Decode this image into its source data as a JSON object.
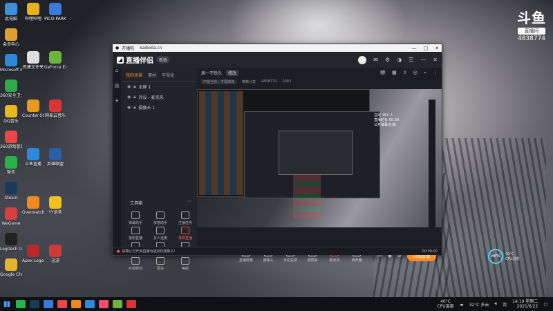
{
  "desktop": {
    "icons": [
      {
        "label": "此电脑",
        "color": "#3e8fd9"
      },
      {
        "label": "会员中心",
        "color": "#e0a030"
      },
      {
        "label": "Microsoft Edge",
        "color": "#2b8ad9"
      },
      {
        "label": "360安全卫士",
        "color": "#2ea84a"
      },
      {
        "label": "QQ音乐",
        "color": "#e8b820"
      },
      {
        "label": "360游戏管家",
        "color": "#e94848"
      },
      {
        "label": "微信",
        "color": "#27b34a"
      },
      {
        "label": "Steam",
        "color": "#1c3a5a"
      },
      {
        "label": "WeGame",
        "color": "#d64040"
      },
      {
        "label": "Logitech G HUB",
        "color": "#222"
      },
      {
        "label": "Google Chrome",
        "color": "#e4b42a"
      }
    ],
    "icons_col2": [
      {
        "label": "哔哩哔哩",
        "color": "#e8b020"
      },
      {
        "label": "新建文件夹",
        "color": "#ddd"
      },
      {
        "label": "Counter-Strike",
        "color": "#e89a20"
      },
      {
        "label": "斗鱼直播",
        "color": "#2b8ad9"
      },
      {
        "label": "Overwatch",
        "color": "#f08a20"
      },
      {
        "label": "Apex Legends",
        "color": "#b82a2a"
      }
    ],
    "icons_col3": [
      {
        "label": "PICO PARK",
        "color": "#3a7ad9"
      },
      {
        "label": "GeForce Experience",
        "color": "#6db33f"
      },
      {
        "label": "网易云音乐",
        "color": "#d33"
      },
      {
        "label": "英雄联盟",
        "color": "#2a5ea8"
      },
      {
        "label": "YY语音",
        "color": "#f0c020"
      },
      {
        "label": "迅游",
        "color": "#cc3a3a"
      }
    ]
  },
  "watermark": {
    "logo": "斗鱼",
    "badge": "直播间",
    "room_id": "4838774"
  },
  "app": {
    "titlebar": {
      "title": "开播啦",
      "url": "kaiboila.cn",
      "min": "—",
      "max": "□",
      "close": "✕"
    },
    "brand": "直播伴侣",
    "version": "新版",
    "left_tabs": [
      "我的场景",
      "素材",
      "可视化"
    ],
    "scenes": [
      {
        "label": "全屏 1"
      },
      {
        "label": "外设 - 麦克风"
      },
      {
        "label": "摄像头 1"
      }
    ],
    "tools_title": "工具箱",
    "tools": [
      {
        "label": "弹幕助手",
        "highlight": false
      },
      {
        "label": "房管助手",
        "highlight": false
      },
      {
        "label": "主播任务",
        "highlight": false
      },
      {
        "label": "视频直播",
        "highlight": false
      },
      {
        "label": "多人连麦",
        "highlight": false
      },
      {
        "label": "录屏直播",
        "highlight": true
      },
      {
        "label": "虚拟形象",
        "highlight": false
      },
      {
        "label": "弹幕库",
        "highlight": false
      },
      {
        "label": "数据助手",
        "highlight": false
      },
      {
        "label": "礼物特效",
        "highlight": false
      },
      {
        "label": "更多",
        "highlight": false
      },
      {
        "label": "美颜",
        "highlight": false
      }
    ],
    "room": {
      "title": "周一不快乐",
      "tag": "修改",
      "category": "中望当前：不再推荐",
      "status": "推荐分享",
      "room_label": "4838774",
      "hot": "1093"
    },
    "preview_overlay": "在线 163 人\n直播时长 00:00\n公开弹幕/礼物",
    "controls": [
      {
        "label": "直播屏幕",
        "mic": false
      },
      {
        "label": "摄像头",
        "mic": false
      },
      {
        "label": "手机投屏",
        "mic": false
      },
      {
        "label": "录屏助",
        "mic": false
      },
      {
        "label": "麦克风",
        "mic": true
      },
      {
        "label": "扬声器",
        "mic": false
      }
    ],
    "live_button": "开始直播",
    "status_warning": "请确认已开启直播功能授权摄像头!",
    "status_time": "00:00:00"
  },
  "perf": {
    "percent": "56%",
    "label1": "40°C",
    "label2": "CPU温度"
  },
  "taskbar": {
    "tray_temp": "40°C",
    "tray_temp_label": "CPU温度",
    "weather": "32°C 多云",
    "lang": "英",
    "time": "14:19 星期二",
    "date": "2021/6/22"
  }
}
